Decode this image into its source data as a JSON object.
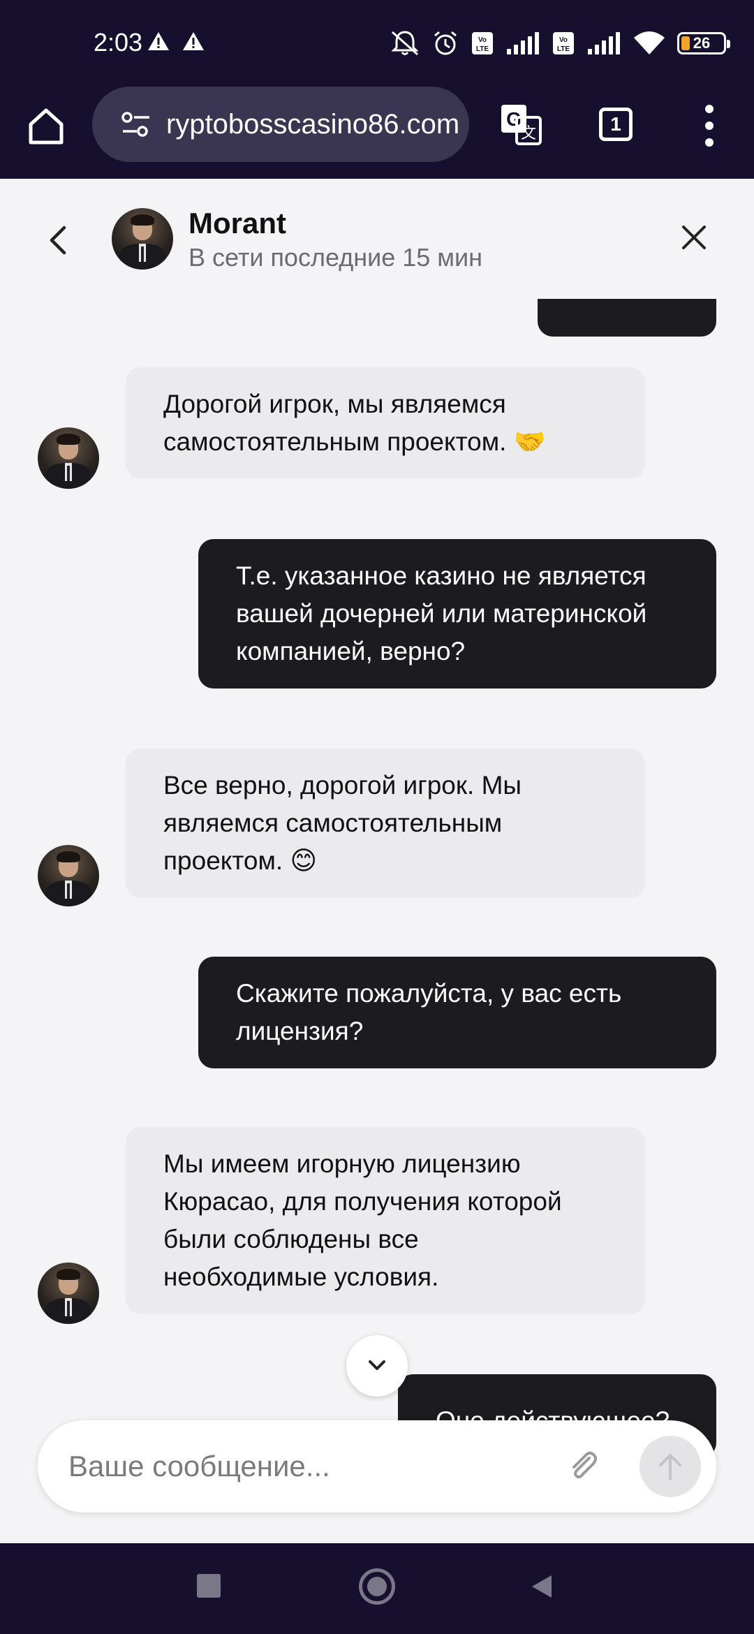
{
  "status_bar": {
    "time": "2:03",
    "battery_level": "26",
    "icons": [
      "warning-icon",
      "warning-icon",
      "mute-icon",
      "alarm-icon",
      "volte-icon",
      "signal-icon",
      "volte-icon",
      "signal-icon",
      "wifi-icon",
      "battery-icon"
    ]
  },
  "browser": {
    "url": "ryptobosscasino86.com",
    "tab_count": "1"
  },
  "chat": {
    "contact_name": "Morant",
    "contact_status": "В сети последние 15 мин",
    "messages": [
      {
        "from": "user",
        "text": ""
      },
      {
        "from": "agent",
        "text": "Дорогой игрок, мы являемся\nсамостоятельным проектом. 🤝"
      },
      {
        "from": "user",
        "text": "Т.е. указанное казино не является\nвашей дочерней или материнской\nкомпанией, верно?"
      },
      {
        "from": "agent",
        "text": "Все верно, дорогой игрок. Мы\nявляемся самостоятельным\nпроектом. 😊"
      },
      {
        "from": "user",
        "text": "Скажите пожалуйста, у вас есть\nлицензия?"
      },
      {
        "from": "agent",
        "text": "Мы имеем игорную лицензию\nКюрасао, для получения которой\nбыли соблюдены все\nнеобходимые условия."
      },
      {
        "from": "user",
        "text": "Оно действующее?"
      }
    ]
  },
  "composer": {
    "placeholder": "Ваше сообщение..."
  },
  "colors": {
    "system_bar": "#16102e",
    "outgoing_bubble": "#1c1c20",
    "incoming_bubble": "#ebebee",
    "background": "#f4f4f6"
  }
}
